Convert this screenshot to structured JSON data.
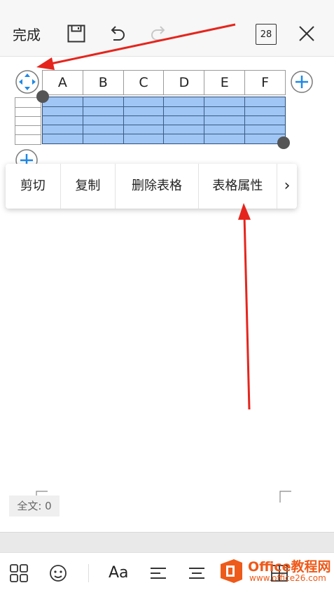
{
  "toolbar": {
    "done_label": "完成",
    "page_badge": "28"
  },
  "table": {
    "columns": [
      "A",
      "B",
      "C",
      "D",
      "E",
      "F"
    ]
  },
  "context_menu": {
    "items": [
      "剪切",
      "复制",
      "删除表格",
      "表格属性"
    ],
    "more_glyph": "›"
  },
  "status": {
    "word_count": "全文: 0"
  },
  "bottom_bar": {
    "font_label": "Aa"
  },
  "watermark": {
    "brand": "Office教程网",
    "url": "www.office26.com"
  },
  "colors": {
    "accent": "#1e88e5",
    "selection": "#9fc6f4",
    "arrow": "#e5251d",
    "watermark": "#ee5a1a"
  }
}
